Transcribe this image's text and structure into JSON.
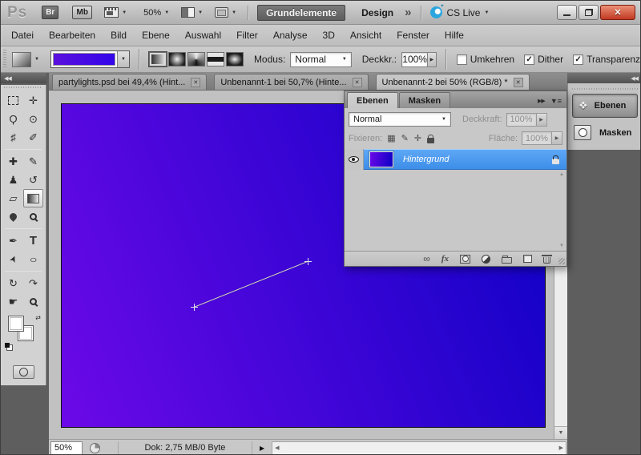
{
  "topbar": {
    "logo": "Ps",
    "bridge_label": "Br",
    "minibridge_label": "Mb",
    "zoom_level": "50%",
    "workspaces": {
      "active": "Grundelemente",
      "other": "Design",
      "more": "»"
    },
    "cslive_label": "CS Live"
  },
  "menubar": {
    "items": [
      "Datei",
      "Bearbeiten",
      "Bild",
      "Ebene",
      "Auswahl",
      "Filter",
      "Analyse",
      "3D",
      "Ansicht",
      "Fenster",
      "Hilfe"
    ]
  },
  "options": {
    "modus_label": "Modus:",
    "modus_value": "Normal",
    "opacity_label": "Deckkr.:",
    "opacity_value": "100%",
    "checkboxes": [
      {
        "label": "Umkehren",
        "mark": ""
      },
      {
        "label": "Dither",
        "mark": "✓"
      },
      {
        "label": "Transparenz",
        "mark": "✓"
      }
    ]
  },
  "tabs": [
    {
      "title": "partylights.psd bei 49,4% (Hint...",
      "close": "✕"
    },
    {
      "title": "Unbenannt-1 bei 50,7% (Hinte...",
      "close": "✕"
    },
    {
      "title": "Unbenannt-2 bei 50% (RGB/8) *",
      "close": "✕"
    }
  ],
  "tools": {
    "collapse": "◀◀",
    "items": [
      {
        "name": "rectangular-marquee",
        "glyph": ""
      },
      {
        "name": "move",
        "glyph": "✛"
      },
      {
        "name": "lasso",
        "glyph": "Ϙ"
      },
      {
        "name": "quick-selection",
        "glyph": "⊙"
      },
      {
        "name": "crop",
        "glyph": "♯"
      },
      {
        "name": "eyedropper",
        "glyph": "✐"
      },
      {
        "name": "spot-healing",
        "glyph": "✚"
      },
      {
        "name": "brush",
        "glyph": "✎"
      },
      {
        "name": "clone-stamp",
        "glyph": "♟"
      },
      {
        "name": "history-brush",
        "glyph": "↺"
      },
      {
        "name": "eraser",
        "glyph": "▱"
      },
      {
        "name": "gradient",
        "glyph": ""
      },
      {
        "name": "blur",
        "glyph": ""
      },
      {
        "name": "dodge",
        "glyph": ""
      },
      {
        "name": "pen",
        "glyph": "✒"
      },
      {
        "name": "type",
        "glyph": "T"
      },
      {
        "name": "path-selection",
        "glyph": "➤"
      },
      {
        "name": "ellipse-shape",
        "glyph": "○"
      },
      {
        "name": "rotate-3d",
        "glyph": "↻"
      },
      {
        "name": "roll-3d",
        "glyph": "↷"
      },
      {
        "name": "hand",
        "glyph": "☛"
      },
      {
        "name": "zoom-tool",
        "glyph": ""
      }
    ]
  },
  "layers_panel": {
    "tab_ebenen": "Ebenen",
    "tab_masken": "Masken",
    "expand_icon": "▶▶",
    "menu_icon": "▼≡",
    "blend_mode": "Normal",
    "opacity_label": "Deckkraft:",
    "opacity_value": "100%",
    "lock_label": "Fixieren:",
    "fill_label": "Fläche:",
    "fill_value": "100%",
    "layer_name": "Hintergrund",
    "fx_icon": "fx",
    "link_icon": "∞"
  },
  "dock": {
    "collapse": "◀◀",
    "ebenen_label": "Ebenen",
    "ebenen_icon": "❖",
    "masken_label": "Masken"
  },
  "statusbar": {
    "zoom_value": "50%",
    "doc_info": "Dok: 2,75 MB/0 Byte"
  },
  "icons": {
    "dropdown": "▼",
    "spin_right": "▶",
    "scroll_up": "▲",
    "scroll_down": "▼",
    "scroll_left": "◀",
    "scroll_right": "▶",
    "swap": "⇄",
    "checker": "▦",
    "brush_small": "✎",
    "move_small": "✛"
  },
  "colors": {
    "canvas_gradient_from": "#6c09e8",
    "canvas_gradient_to": "#0b01c4",
    "selection_blue": "#4a98f0"
  }
}
